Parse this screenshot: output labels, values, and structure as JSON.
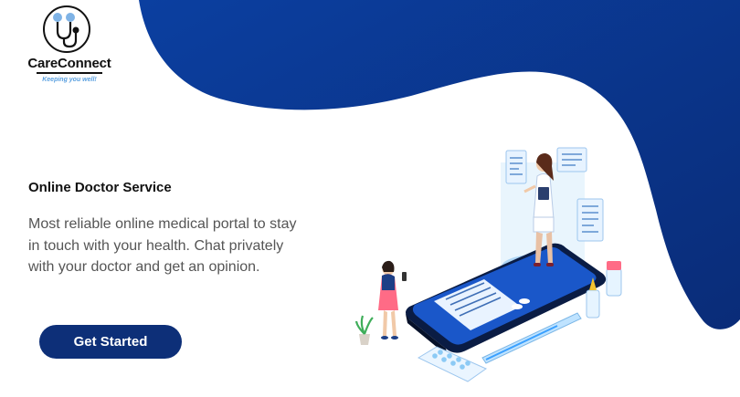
{
  "brand": {
    "name": "CareConnect",
    "tagline": "Keeping you well!"
  },
  "hero": {
    "title": "Online Doctor Service",
    "description": "Most reliable online medical portal to stay in touch with your health. Chat privately with your doctor and get an opinion.",
    "cta_label": "Get Started"
  },
  "colors": {
    "primary_dark": "#0d2f78",
    "primary_mid": "#0b3a9c",
    "accent_light": "#5aa0e0"
  },
  "icons": {
    "logo": "stethoscope-icon"
  }
}
